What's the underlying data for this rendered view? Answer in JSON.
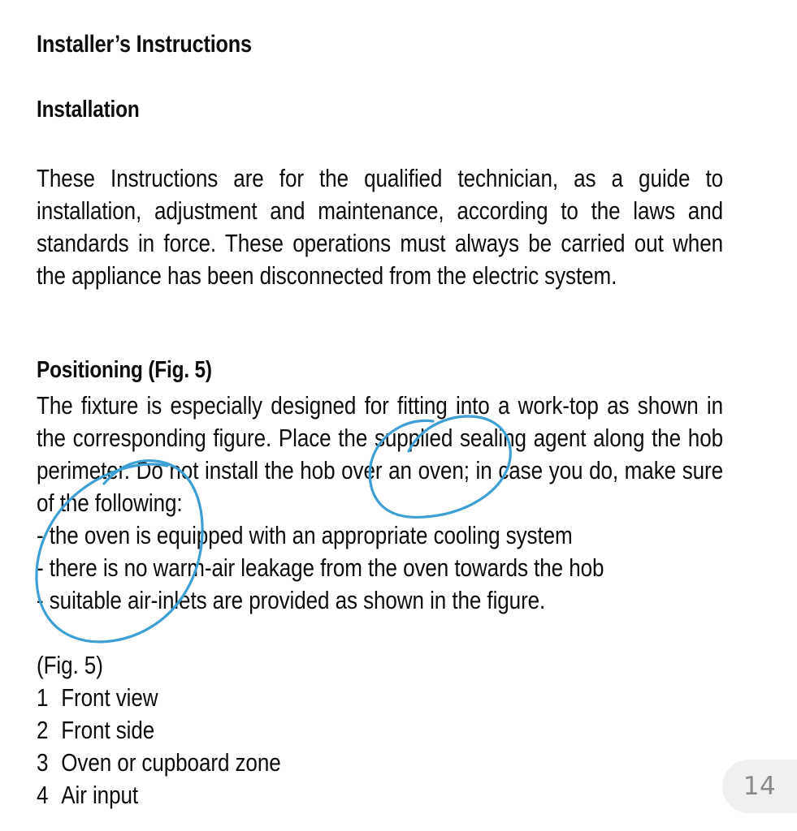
{
  "document": {
    "title": "Installer’s Instructions",
    "section_heading": "Installation",
    "intro_paragraph": "These Instructions are for the qualified technician, as a guide to installation, adjustment and maintenance, according to the laws and standards in force. These operations must always be carried out when the appliance has been disconnected from the electric system.",
    "positioning_heading": "Positioning (Fig. 5)",
    "positioning_paragraph": "The fixture is especially designed for fitting into a work-top as shown in the corresponding figure. Place the supplied sealing agent along the hob perimeter. Do not install the hob over an oven; in case you do, make sure of the following:",
    "bullets": [
      "- the oven is equipped with an appropriate cooling system",
      "- there is no warm-air leakage from the oven towards the hob",
      "- suitable air-inlets are provided as shown in the figure."
    ],
    "figure_caption": "(Fig. 5)",
    "figure_legend": [
      {
        "num": "1",
        "label": "Front view"
      },
      {
        "num": "2",
        "label": "Front side"
      },
      {
        "num": "3",
        "label": "Oven or cupboard zone"
      },
      {
        "num": "4",
        "label": "Air input"
      }
    ]
  },
  "annotations": {
    "ink_color": "#3e9fd4",
    "marks": [
      {
        "name": "blue-ellipse-left",
        "description": "hand-drawn blue ellipse circling the bullet list"
      },
      {
        "name": "blue-ellipse-right",
        "description": "hand-drawn blue ellipse circling “Do not install” phrase"
      }
    ]
  },
  "page_badge": {
    "number": "14",
    "background": "#f0f0f0",
    "text_color": "#8a8a8a"
  }
}
